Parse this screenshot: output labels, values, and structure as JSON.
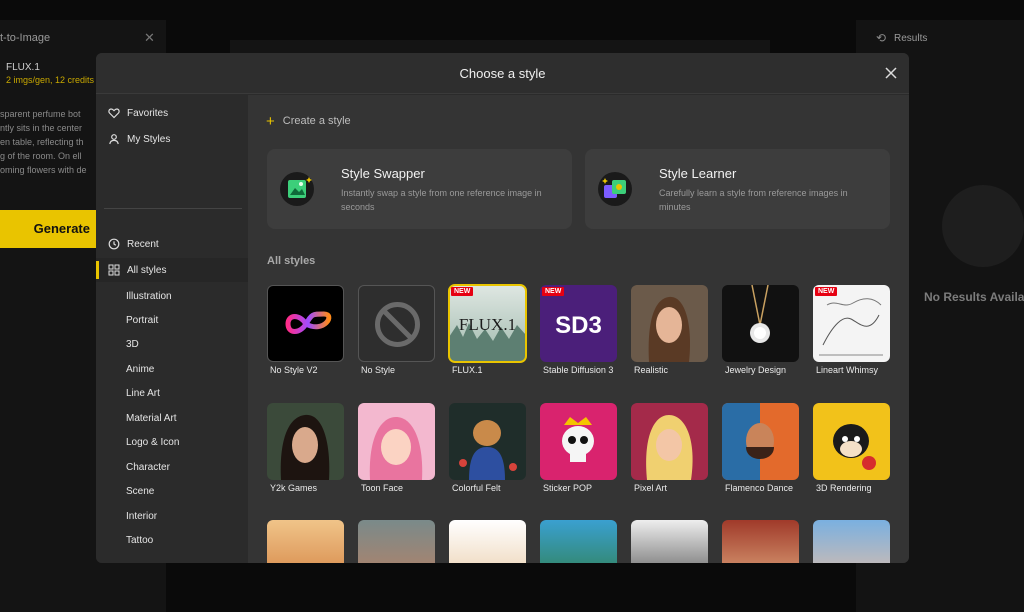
{
  "background": {
    "left_panel": {
      "title": "t-to-Image",
      "model": "FLUX.1",
      "credits": "2 imgs/gen, 12 credits",
      "prompt_lines": [
        "sparent perfume bot",
        "ntly sits in the center",
        "en table, reflecting th",
        "g of the room. On ell",
        "oming flowers with de"
      ],
      "generate_label": "Generate"
    },
    "right_panel": {
      "title": "Results",
      "empty_text": "No Results Availa"
    }
  },
  "modal": {
    "title": "Choose a style",
    "sidebar": {
      "top_items": [
        {
          "label": "Favorites",
          "icon": "heart-icon"
        },
        {
          "label": "My Styles",
          "icon": "user-icon"
        }
      ],
      "items": [
        {
          "label": "Recent",
          "icon": "clock-icon"
        },
        {
          "label": "All styles",
          "icon": "grid-icon"
        }
      ],
      "categories": [
        "Illustration",
        "Portrait",
        "3D",
        "Anime",
        "Line Art",
        "Material Art",
        "Logo & Icon",
        "Character",
        "Scene",
        "Interior",
        "Tattoo"
      ]
    },
    "create_label": "Create a style",
    "cards": [
      {
        "title": "Style Swapper",
        "desc": "Instantly swap a style from one reference image in seconds"
      },
      {
        "title": "Style Learner",
        "desc": "Carefully learn a style from reference images in minutes"
      }
    ],
    "section_title": "All styles",
    "new_badge": "NEW",
    "thumb_text": {
      "flux": "FLUX.1",
      "sd3": "SD3"
    },
    "styles_row1": [
      {
        "label": "No Style V2",
        "new": false
      },
      {
        "label": "No Style",
        "new": false
      },
      {
        "label": "FLUX.1",
        "new": true
      },
      {
        "label": "Stable Diffusion 3",
        "new": true
      },
      {
        "label": "Realistic",
        "new": false
      },
      {
        "label": "Jewelry Design",
        "new": false
      },
      {
        "label": "Lineart Whimsy",
        "new": true
      }
    ],
    "styles_row2": [
      {
        "label": "Y2k Games"
      },
      {
        "label": "Toon Face"
      },
      {
        "label": "Colorful Felt"
      },
      {
        "label": "Sticker POP"
      },
      {
        "label": "Pixel Art"
      },
      {
        "label": "Flamenco Dance"
      },
      {
        "label": "3D Rendering"
      }
    ]
  },
  "colors": {
    "accent": "#e9c400",
    "new_badge": "#e60012",
    "modal_bg": "#343434",
    "sidebar_bg": "#2b2b2b"
  }
}
